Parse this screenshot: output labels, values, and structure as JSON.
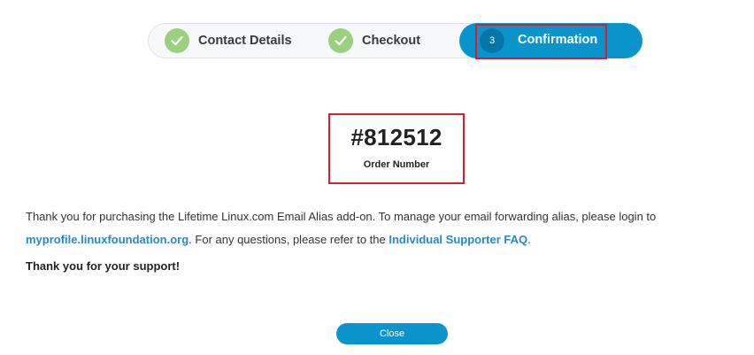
{
  "stepper": {
    "steps": [
      {
        "label": "Contact Details",
        "state": "completed",
        "icon": "check-icon"
      },
      {
        "label": "Checkout",
        "state": "completed",
        "icon": "check-icon"
      },
      {
        "label": "Confirmation",
        "state": "active",
        "number": "3"
      }
    ]
  },
  "order": {
    "number": "#812512",
    "label": "Order Number"
  },
  "message": {
    "text_before": "Thank you for purchasing the Lifetime Linux.com Email Alias add-on. To manage your email forwarding alias, please login to",
    "profile_link": "myprofile.linuxfoundation.org",
    "text_middle": ". For any questions, please refer to the",
    "faq_link": "Individual Supporter FAQ",
    "text_after": "."
  },
  "thanks": "Thank you for your support!",
  "close_button": "Close",
  "colors": {
    "accent": "#0a94cc",
    "check": "#9bd17e",
    "highlight": "#d61f2b",
    "link": "#2a87bf"
  }
}
